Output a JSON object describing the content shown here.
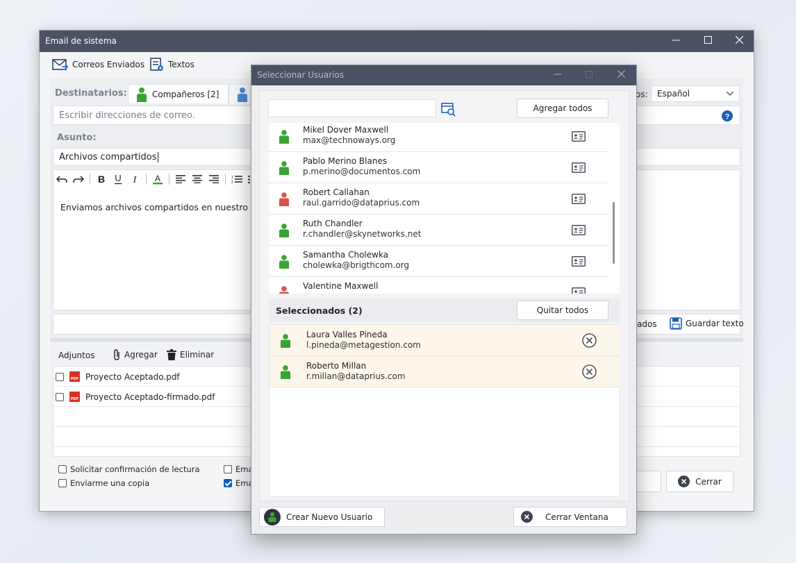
{
  "main_window": {
    "title": "Email de sistema",
    "toolbar": {
      "sent_label": "Correos Enviados",
      "texts_label": "Textos"
    },
    "recipients_label": "Destinatarios:",
    "tab_companions": "Compañeros [2]",
    "language_label_partial": "os:",
    "language_value": "Español",
    "address_placeholder": "Escribir direcciones de correo.",
    "subject_label": "Asunto:",
    "subject_value": "Archivos compartidos",
    "body_text": "Enviamos archivos compartidos en nuestro sist",
    "saved_partial": "ados",
    "save_text_label": "Guardar texto",
    "attachments": {
      "label": "Adjuntos",
      "add_label": "Agregar",
      "delete_label": "Eliminar",
      "files": [
        "Proyecto Aceptado.pdf",
        "Proyecto Aceptado-firmado.pdf"
      ]
    },
    "options": {
      "read_confirmation": "Solicitar confirmación de lectura",
      "send_copy": "Enviarme una copia",
      "ema1": "Ema",
      "ema2": "Ema",
      "ema2_checked": true
    },
    "close_label": "Cerrar"
  },
  "dialog": {
    "title": "Seleccionar Usuarios",
    "add_all_label": "Agregar todos",
    "users": [
      {
        "name": "Mikel Dover Maxwell",
        "email": "max@technoways.org",
        "color": "#3aa335"
      },
      {
        "name": "Pablo Merino Blanes",
        "email": "p.merino@documentos.com",
        "color": "#3aa335"
      },
      {
        "name": "Robert Callahan",
        "email": "raul.garrido@dataprius.com",
        "color": "#d9534f"
      },
      {
        "name": "Ruth Chandler",
        "email": "r.chandler@skynetworks.net",
        "color": "#3aa335"
      },
      {
        "name": "Samantha Cholewka",
        "email": "cholewka@brigthcom.org",
        "color": "#3aa335"
      },
      {
        "name": "Valentine Maxwell",
        "email": "",
        "color": "#d9534f"
      }
    ],
    "selected_label": "Seleccionados (2)",
    "remove_all_label": "Quitar todos",
    "selected": [
      {
        "name": "Laura Valles Pineda",
        "email": "l.pineda@metagestion.com"
      },
      {
        "name": "Roberto Millan",
        "email": "r.millan@dataprius.com"
      }
    ],
    "create_user_label": "Crear Nuevo Usuario",
    "close_window_label": "Cerrar Ventana"
  },
  "colors": {
    "titlebar": "#4b5264",
    "green_user": "#3aa335",
    "red_user": "#d9534f",
    "accent_blue": "#0a5fc7"
  }
}
